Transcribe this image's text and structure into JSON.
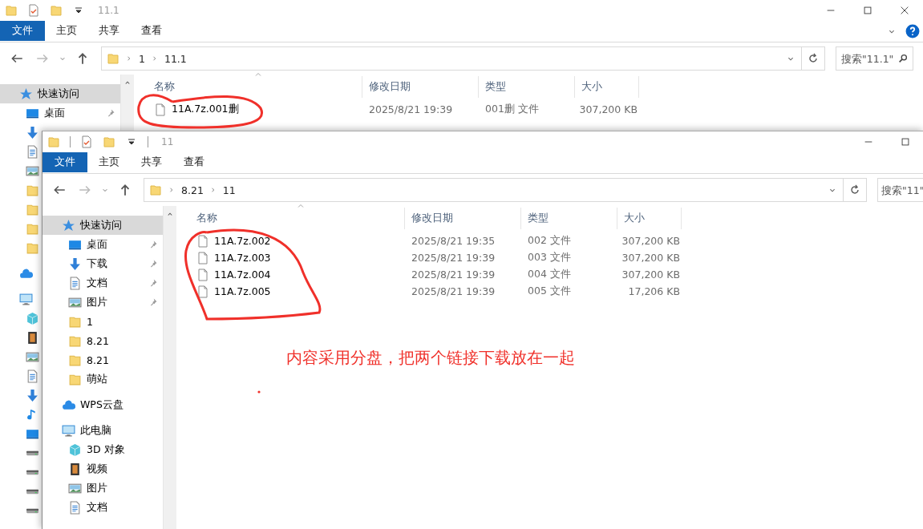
{
  "windows": [
    {
      "title": "11.1",
      "controls": [
        {
          "kind": "minimize"
        },
        {
          "kind": "maximize"
        },
        {
          "kind": "close"
        }
      ],
      "ribbon_extras": true,
      "tabs": [
        {
          "label": "文件",
          "selected": true
        },
        {
          "label": "主页",
          "selected": false
        },
        {
          "label": "共享",
          "selected": false
        },
        {
          "label": "查看",
          "selected": false
        }
      ],
      "path": [
        "1",
        "11.1"
      ],
      "search": {
        "placeholder": "搜索\"11.1\"",
        "icon": true
      },
      "sidebar": [
        {
          "kind": "star",
          "text": "快速访问",
          "selected": true,
          "children": [
            {
              "kind": "desktop",
              "text": "桌面",
              "pinned": true,
              "selected": false
            },
            {
              "kind": "download",
              "selected": false
            },
            {
              "kind": "doc",
              "selected": false
            },
            {
              "kind": "picture",
              "selected": false
            },
            {
              "kind": "folder",
              "selected": false
            },
            {
              "kind": "folder",
              "selected": false
            },
            {
              "kind": "folder",
              "selected": false
            },
            {
              "kind": "folder",
              "selected": false
            }
          ]
        },
        {
          "kind": "cloud",
          "selected": false
        },
        {
          "kind": "pc",
          "selected": false,
          "children": [
            {
              "kind": "cube",
              "selected": false
            },
            {
              "kind": "video",
              "selected": false
            },
            {
              "kind": "picture",
              "selected": false
            },
            {
              "kind": "doc",
              "selected": false
            },
            {
              "kind": "download",
              "selected": false
            },
            {
              "kind": "music",
              "selected": false
            },
            {
              "kind": "desktop",
              "selected": false
            },
            {
              "kind": "drive",
              "selected": false
            },
            {
              "kind": "drive",
              "selected": false
            },
            {
              "kind": "drive",
              "selected": false
            },
            {
              "kind": "drive",
              "selected": false
            }
          ]
        }
      ],
      "columns": [
        "名称",
        "修改日期",
        "类型",
        "大小"
      ],
      "files": [
        {
          "name": "11A.7z.001删",
          "date": "2025/8/21 19:39",
          "type": "001删 文件",
          "size": "307,200 KB"
        }
      ]
    },
    {
      "title": "11",
      "controls": [
        {
          "kind": "minimize"
        },
        {
          "kind": "maximize"
        }
      ],
      "ribbon_extras": false,
      "tabs": [
        {
          "label": "文件",
          "selected": true
        },
        {
          "label": "主页",
          "selected": false
        },
        {
          "label": "共享",
          "selected": false
        },
        {
          "label": "查看",
          "selected": false
        }
      ],
      "path": [
        "8.21",
        "11"
      ],
      "search": {
        "placeholder": "搜索\"11\"",
        "icon": false
      },
      "sidebar": [
        {
          "kind": "star",
          "text": "快速访问",
          "selected": true,
          "children": [
            {
              "kind": "desktop",
              "text": "桌面",
              "pinned": true,
              "selected": false
            },
            {
              "kind": "download",
              "text": "下载",
              "pinned": true,
              "selected": false
            },
            {
              "kind": "doc",
              "text": "文档",
              "pinned": true,
              "selected": false
            },
            {
              "kind": "picture",
              "text": "图片",
              "pinned": true,
              "selected": false
            },
            {
              "kind": "folder",
              "text": "1",
              "selected": false
            },
            {
              "kind": "folder",
              "text": "8.21",
              "selected": false
            },
            {
              "kind": "folder",
              "text": "8.21",
              "selected": false
            },
            {
              "kind": "folder",
              "text": "萌站",
              "selected": false
            }
          ]
        },
        {
          "kind": "cloud",
          "text": "WPS云盘",
          "selected": false
        },
        {
          "kind": "pc",
          "text": "此电脑",
          "selected": false,
          "children": [
            {
              "kind": "cube",
              "text": "3D 对象",
              "selected": false
            },
            {
              "kind": "video",
              "text": "视频",
              "selected": false
            },
            {
              "kind": "picture",
              "text": "图片",
              "selected": false
            },
            {
              "kind": "doc",
              "text": "文档",
              "selected": false
            }
          ]
        }
      ],
      "columns": [
        "名称",
        "修改日期",
        "类型",
        "大小"
      ],
      "files": [
        {
          "name": "11A.7z.002",
          "date": "2025/8/21 19:35",
          "type": "002 文件",
          "size": "307,200 KB"
        },
        {
          "name": "11A.7z.003",
          "date": "2025/8/21 19:39",
          "type": "003 文件",
          "size": "307,200 KB"
        },
        {
          "name": "11A.7z.004",
          "date": "2025/8/21 19:39",
          "type": "004 文件",
          "size": "307,200 KB"
        },
        {
          "name": "11A.7z.005",
          "date": "2025/8/21 19:39",
          "type": "005 文件",
          "size": "17,206 KB"
        }
      ]
    }
  ],
  "annotation": {
    "note": "内容采用分盘，把两个链接下载放在一起"
  }
}
